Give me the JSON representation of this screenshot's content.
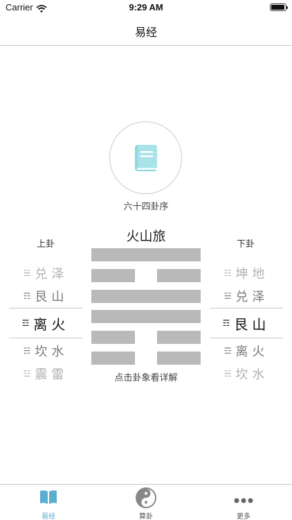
{
  "status": {
    "carrier": "Carrier",
    "time": "9:29 AM"
  },
  "nav": {
    "title": "易经"
  },
  "book": {
    "label": "六十四卦序",
    "icon": "book-icon",
    "color": "#8fd8e0"
  },
  "upper": {
    "title": "上卦",
    "items": [
      {
        "sym": "☱",
        "name": "兑泽"
      },
      {
        "sym": "☶",
        "name": "艮山"
      },
      {
        "sym": "☲",
        "name": "离火"
      },
      {
        "sym": "☵",
        "name": "坎水"
      },
      {
        "sym": "☳",
        "name": "震雷"
      }
    ],
    "selected_index": 2
  },
  "lower": {
    "title": "下卦",
    "items": [
      {
        "sym": "☷",
        "name": "坤地"
      },
      {
        "sym": "☱",
        "name": "兑泽"
      },
      {
        "sym": "☶",
        "name": "艮山"
      },
      {
        "sym": "☲",
        "name": "离火"
      },
      {
        "sym": "☵",
        "name": "坎水"
      }
    ],
    "selected_index": 2
  },
  "hexagram": {
    "name": "火山旅",
    "lines_top_to_bottom": [
      "yang",
      "yin",
      "yang",
      "yang",
      "yin",
      "yin"
    ],
    "hint": "点击卦象看详解"
  },
  "tabs": [
    {
      "label": "易经",
      "icon": "book-tab-icon",
      "active": true
    },
    {
      "label": "算卦",
      "icon": "yin-yang-icon",
      "active": false
    },
    {
      "label": "更多",
      "icon": "more-dots-icon",
      "active": false
    }
  ],
  "colors": {
    "accent": "#5aaed0",
    "inactive": "#666666",
    "line": "#b9b9b9"
  }
}
